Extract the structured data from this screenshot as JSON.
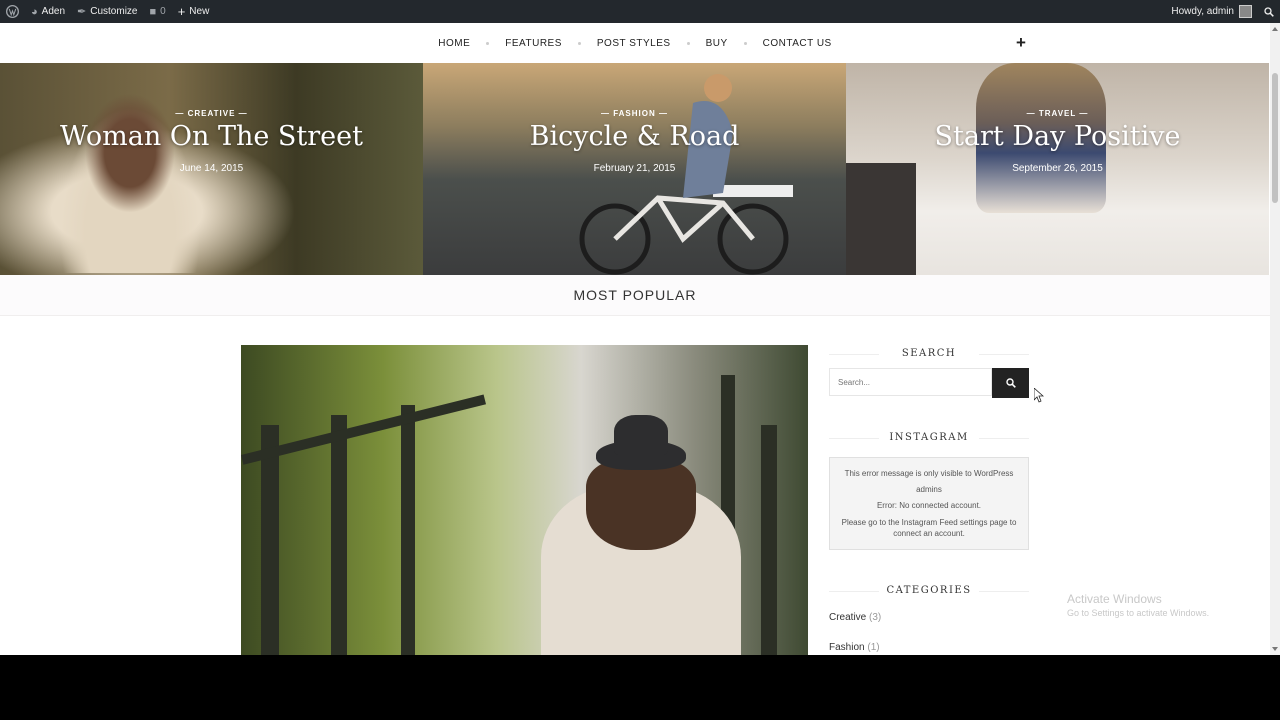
{
  "adminbar": {
    "site_name": "Aden",
    "customize": "Customize",
    "comments_count": "0",
    "new_label": "New",
    "howdy": "Howdy, admin"
  },
  "nav": {
    "items": [
      "HOME",
      "FEATURES",
      "POST STYLES",
      "BUY",
      "CONTACT US"
    ],
    "plus": "+"
  },
  "slides": [
    {
      "category": "— CREATIVE —",
      "title": "Woman On The Street",
      "date": "June 14, 2015"
    },
    {
      "category": "— FASHION —",
      "title": "Bicycle & Road",
      "date": "February 21, 2015"
    },
    {
      "category": "— TRAVEL —",
      "title": "Start Day Positive",
      "date": "September 26, 2015"
    }
  ],
  "popular": {
    "title": "MOST POPULAR"
  },
  "sidebar": {
    "search_title": "SEARCH",
    "search_placeholder": "Search...",
    "instagram_title": "INSTAGRAM",
    "instagram_msg1": "This error message is only visible to WordPress admins",
    "instagram_msg2": "Error: No connected account.",
    "instagram_msg3": "Please go to the Instagram Feed settings page to connect an account.",
    "categories_title": "CATEGORIES",
    "categories": [
      {
        "name": "Creative",
        "count": "(3)"
      },
      {
        "name": "Fashion",
        "count": "(1)"
      }
    ]
  },
  "watermark": {
    "line1": "Activate Windows",
    "line2": "Go to Settings to activate Windows."
  },
  "colors": {
    "adminbar": "#23282d",
    "button": "#222222"
  }
}
